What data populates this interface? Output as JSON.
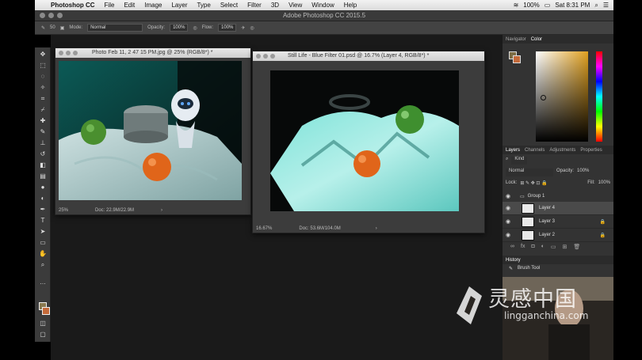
{
  "menubar": {
    "apple": "",
    "items": [
      "Photoshop CC",
      "File",
      "Edit",
      "Image",
      "Layer",
      "Type",
      "Select",
      "Filter",
      "3D",
      "View",
      "Window",
      "Help"
    ],
    "battery": "100%",
    "clock": "Sat 8:31 PM"
  },
  "app_title": "Adobe Photoshop CC 2015.5",
  "options": {
    "brush_size": "50",
    "mode_label": "Mode:",
    "mode_value": "Normal",
    "opacity_label": "Opacity:",
    "opacity_value": "100%",
    "flow_label": "Flow:",
    "flow_value": "100%"
  },
  "doc1": {
    "title": "Photo Feb 11, 2 47 15 PM.jpg @ 25% (RGB/8*) *",
    "zoom": "25%",
    "docsize": "Doc: 22.9M/22.9M"
  },
  "doc2": {
    "title": "Still Life - Blue Filter 01.psd @ 16.7% (Layer 4, RGB/8*) *",
    "zoom": "16.67%",
    "docsize": "Doc: 53.6M/104.0M"
  },
  "color_panel": {
    "tabs": [
      "Navigator",
      "Color"
    ],
    "active": "Color",
    "accent": "#e0a020"
  },
  "layers_panel": {
    "tabs": [
      "Layers",
      "Channels",
      "Adjustments",
      "Properties"
    ],
    "kind": "Kind",
    "blend": "Normal",
    "opacity_label": "Opacity:",
    "opacity": "100%",
    "lock_label": "Lock:",
    "fill_label": "Fill:",
    "fill": "100%",
    "rows": [
      {
        "name": "Group 1",
        "type": "group"
      },
      {
        "name": "Layer 4",
        "type": "layer",
        "selected": true
      },
      {
        "name": "Layer 3",
        "type": "layer"
      },
      {
        "name": "Layer 2",
        "type": "layer"
      }
    ]
  },
  "history_panel": {
    "title": "History",
    "item": "Brush Tool"
  },
  "watermark": {
    "text": "灵感中国",
    "url": "lingganchina.com"
  }
}
